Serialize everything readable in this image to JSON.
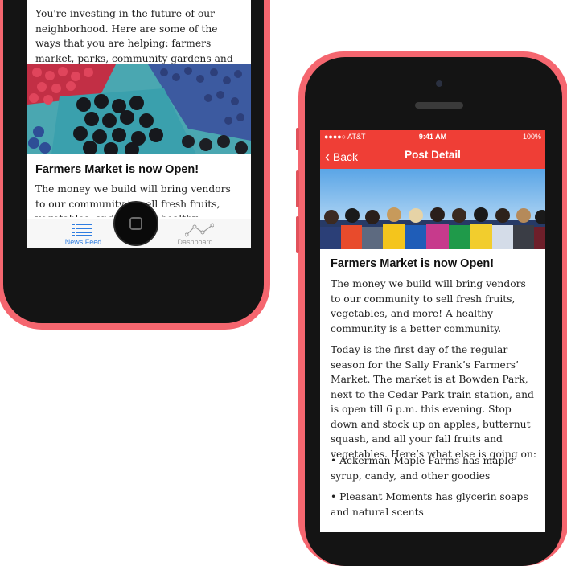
{
  "left_phone": {
    "card_top_text": "You're investing in the future of our neighborhood. Here are some of the ways that you are helping: farmers market, parks, community gardens and picnics will be ...",
    "card2_title": "Farmers Market is now Open!",
    "card2_text": "The money we build will bring vendors to our community to sell fresh fruits, vegetables, and more! A healthy community is a better",
    "tabs": [
      {
        "label": "News Feed",
        "icon": "list-icon",
        "active": true
      },
      {
        "label": "Dashboard",
        "icon": "line-graph-icon",
        "active": false
      }
    ]
  },
  "right_phone": {
    "status": {
      "carrier": "●●●●○ AT&T",
      "time": "9:41 AM",
      "battery": "100%"
    },
    "nav": {
      "back_label": "Back",
      "title": "Post Detail"
    },
    "post_title": "Farmers Market is now Open!",
    "paragraphs": [
      "The money we build will bring vendors to our community to sell fresh fruits, vegetables, and more! A healthy community is a better community.",
      "Today is the first day of the regular season for the Sally Frank’s Farmers’ Market. The market is at Bowden Park, next to the Cedar Park train station, and is open till 6 p.m. this evening. Stop down and stock up on apples, butternut squash, and all your fall fruits and vegetables. Here’s what else is going on:",
      "• Ackerman Maple Farms has maple syrup, candy, and other goodies",
      "• Pleasant Moments has glycerin soaps and natural scents"
    ]
  },
  "colors": {
    "accent_red": "#ef3e36",
    "phone_shell": "#f5666f",
    "tab_active": "#2f7de1",
    "tab_inactive": "#9a9a9a"
  }
}
